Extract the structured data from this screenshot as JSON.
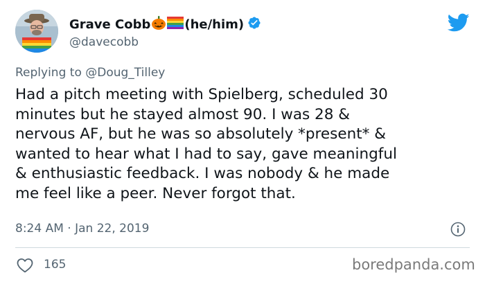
{
  "tweet": {
    "author": {
      "display_name": "Grave Cobb",
      "name_emojis": [
        "pumpkin-emoji",
        "rainbow-flag-emoji"
      ],
      "pronouns": "(he/him)",
      "verified": true,
      "handle": "@davecobb"
    },
    "reply_prefix": "Replying to ",
    "reply_to": "@Doug_Tilley",
    "text_lines": [
      "Had a pitch meeting with Spielberg, scheduled 30",
      "minutes but he stayed almost 90. I was 28 &",
      "nervous AF, but he was so absolutely *present* &",
      "wanted to hear what I had to say, gave meaningful",
      "& enthusiastic feedback. I was nobody & he made",
      "me feel like a peer. Never forgot that."
    ],
    "timestamp": "8:24 AM · Jan 22, 2019",
    "like_count": "165"
  },
  "watermark": "boredpanda.com",
  "colors": {
    "twitter_blue": "#1d9bf0",
    "text_primary": "#0f1419",
    "text_secondary": "#536471"
  },
  "icons": {
    "brand": "twitter-bird-icon",
    "verified": "verified-badge-icon",
    "info": "info-icon",
    "like": "heart-icon"
  }
}
